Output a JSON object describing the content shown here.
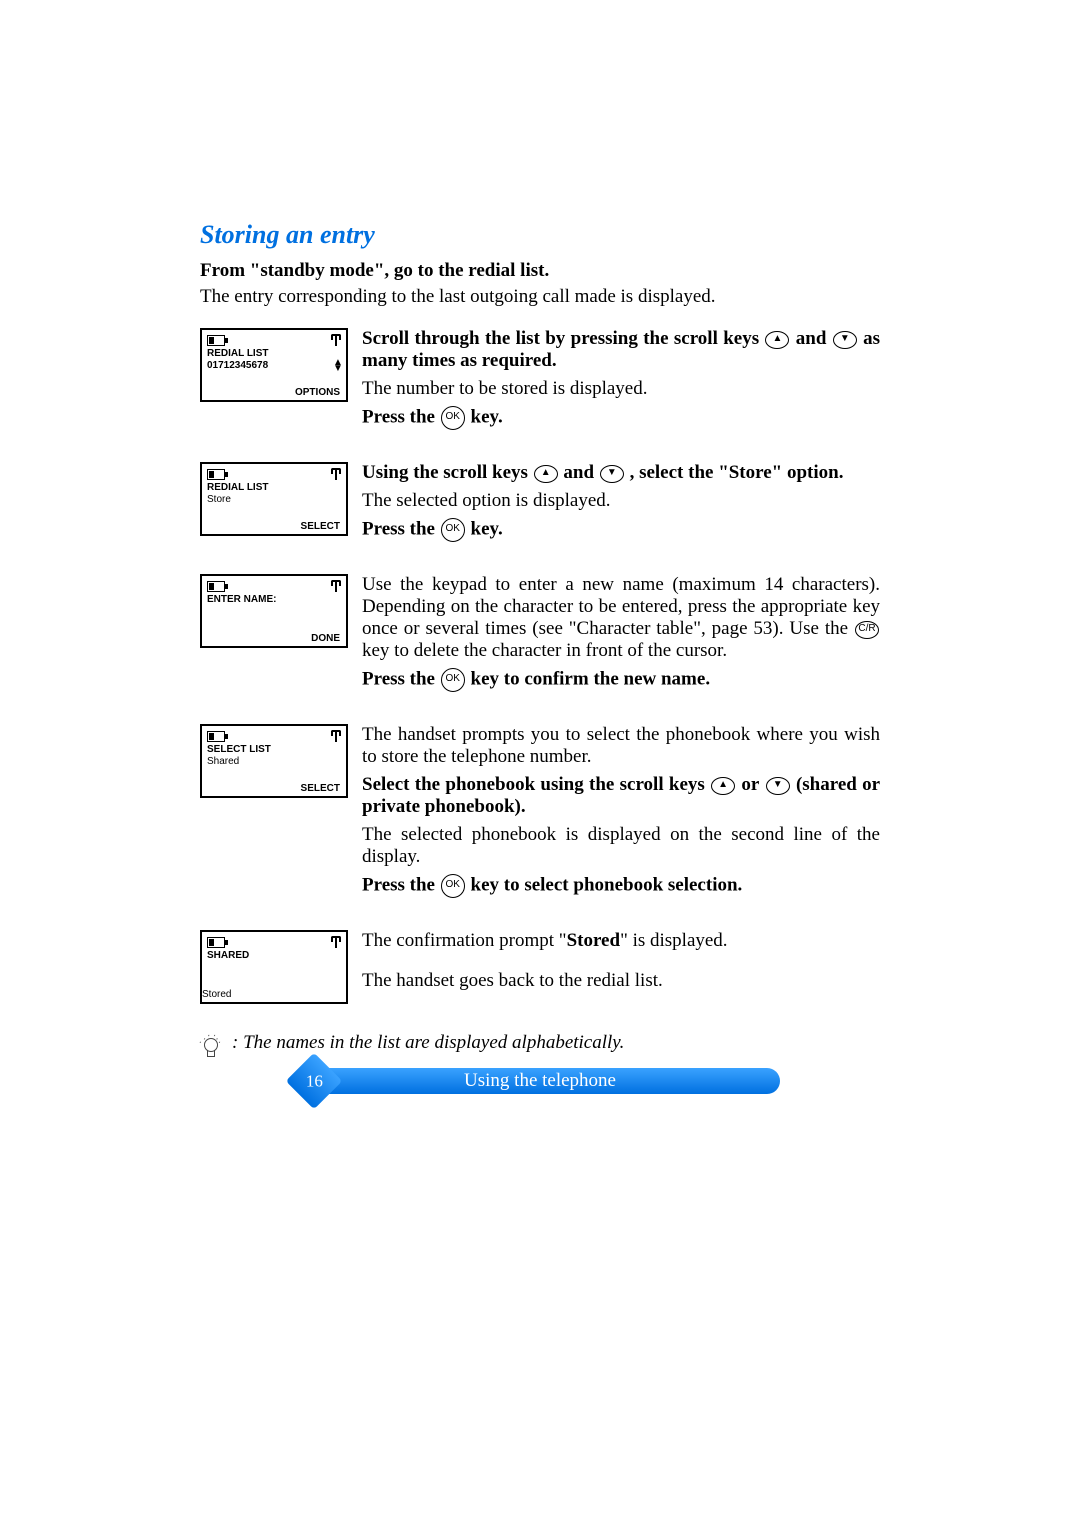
{
  "title": "Storing an entry",
  "lead_bold": "From \"standby mode\", go to the redial list.",
  "lead_plain": "The entry corresponding to the last outgoing call made is displayed.",
  "screens": [
    {
      "line1": "REDIAL LIST",
      "line2": "01712345678",
      "softkey": "OPTIONS",
      "has_updown": true
    },
    {
      "line1": "REDIAL LIST",
      "line2": "Store",
      "softkey": "SELECT",
      "has_updown": false
    },
    {
      "line1": "ENTER NAME:",
      "line2": "",
      "softkey": "DONE",
      "has_updown": false
    },
    {
      "line1": "SELECT LIST",
      "line2": "Shared",
      "softkey": "SELECT",
      "has_updown": false
    },
    {
      "line1": "SHARED",
      "line2": "",
      "softkey": "Stored",
      "has_updown": false,
      "center_softkey": true
    }
  ],
  "instr": {
    "s1": {
      "bold1_a": "Scroll through the list by pressing the scroll keys",
      "bold1_b": "and",
      "bold1_c": "as many times as required.",
      "plain1": "The number to be stored is displayed.",
      "press_a": "Press the",
      "press_b": "key."
    },
    "s2": {
      "bold_a": "Using the scroll keys",
      "bold_b": "and",
      "bold_c": ", select the \"Store\" option.",
      "plain": "The selected option is displayed.",
      "press_a": "Press the",
      "press_b": "key."
    },
    "s3": {
      "p1": "Use the keypad to enter a new name (maximum 14 characters). Depending on the character to be entered, press the appropriate key once or several times (see \"Character table\", page 53). Use the",
      "p1b": "key to delete the character in front of the cursor.",
      "press_a": "Press the",
      "press_b": "key to confirm the new name."
    },
    "s4": {
      "p1": "The handset prompts you to select the phonebook where you wish to store the telephone number.",
      "bold_a": "Select the phonebook using the scroll keys",
      "bold_b": "or",
      "bold_c": "(shared or private phonebook).",
      "p2": "The selected phonebook is displayed on the second line of the display.",
      "press_a": "Press the",
      "press_b": "key to select phonebook selection."
    },
    "s5": {
      "p1a": "The confirmation prompt \"",
      "p1b": "Stored",
      "p1c": "\" is displayed.",
      "p2": "The handset goes back to the redial list."
    }
  },
  "tip": ": The names in the list are displayed alphabetically.",
  "footer": {
    "page": "16",
    "label": "Using the telephone"
  },
  "keys": {
    "ok": "OK",
    "up": "▲",
    "down": "▼",
    "clr": "C/R"
  }
}
